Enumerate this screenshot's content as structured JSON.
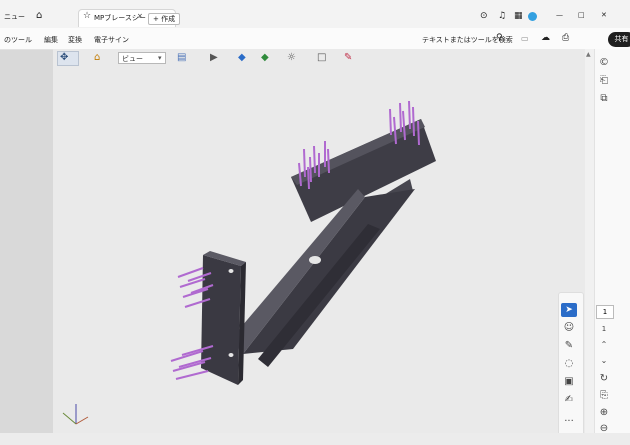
{
  "window": {
    "left_clipped_label": "ニュー",
    "tab_title": "MPブレースシート.nk.pdf",
    "new_tab_label": "+ 作成",
    "controls": {
      "minimize": "—",
      "maximize": "□",
      "close": "✕"
    }
  },
  "menu": {
    "items": [
      "のツール",
      "編集",
      "変換",
      "電子サイン"
    ],
    "search_label": "テキストまたはツールを検索",
    "share_label": "共有"
  },
  "toolbar3d": {
    "view_select_value": "ビュー"
  },
  "right_rail": {
    "page_number": "1",
    "page_total": "1",
    "more_label": "..."
  },
  "colors": {
    "model": "#3e3d46",
    "pins": "#b06ad0",
    "accent_blue": "#2a6cc8"
  }
}
